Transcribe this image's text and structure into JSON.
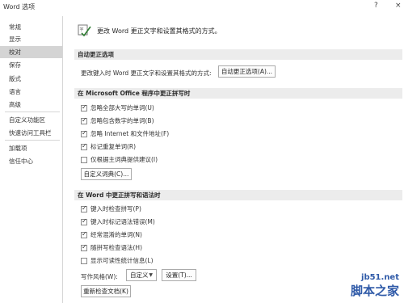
{
  "window": {
    "title": "Word 选项",
    "help_glyph": "?",
    "close_glyph": "×"
  },
  "sidebar": {
    "items": [
      {
        "label": "常规",
        "active": false
      },
      {
        "label": "显示",
        "active": false
      },
      {
        "label": "校对",
        "active": true
      },
      {
        "label": "保存",
        "active": false
      },
      {
        "label": "版式",
        "active": false
      },
      {
        "label": "语言",
        "active": false
      },
      {
        "label": "高级",
        "active": false
      },
      {
        "label": "自定义功能区",
        "active": false
      },
      {
        "label": "快速访问工具栏",
        "active": false
      },
      {
        "label": "加载项",
        "active": false
      },
      {
        "label": "信任中心",
        "active": false
      }
    ]
  },
  "header": {
    "text": "更改 Word 更正文字和设置其格式的方式。"
  },
  "autocorrect": {
    "section_title": "自动更正选项",
    "description": "更改键入时 Word 更正文字和设置其格式的方式:",
    "button": "自动更正选项(A)..."
  },
  "office": {
    "section_title": "在 Microsoft Office 程序中更正拼写时",
    "options": [
      {
        "label": "忽略全部大写的单词(U)",
        "checked": true
      },
      {
        "label": "忽略包含数字的单词(B)",
        "checked": true
      },
      {
        "label": "忽略 Internet 和文件地址(F)",
        "checked": true
      },
      {
        "label": "标记重复单词(R)",
        "checked": true
      },
      {
        "label": "仅根据主词典提供建议(I)",
        "checked": false
      }
    ],
    "dictionary_button": "自定义词典(C)..."
  },
  "word": {
    "section_title": "在 Word 中更正拼写和语法时",
    "options": [
      {
        "label": "键入时检查拼写(P)",
        "checked": true
      },
      {
        "label": "键入时标记语法错误(M)",
        "checked": true
      },
      {
        "label": "经常混淆的单词(N)",
        "checked": true
      },
      {
        "label": "随拼写检查语法(H)",
        "checked": true
      },
      {
        "label": "显示可读性统计信息(L)",
        "checked": false
      }
    ],
    "style_label": "写作风格(W):",
    "style_value": "自定义",
    "settings_button": "设置(T)...",
    "recheck_button": "重新检查文档(K)"
  },
  "watermark": {
    "site": "jb51.net",
    "name": "脚本之家"
  }
}
